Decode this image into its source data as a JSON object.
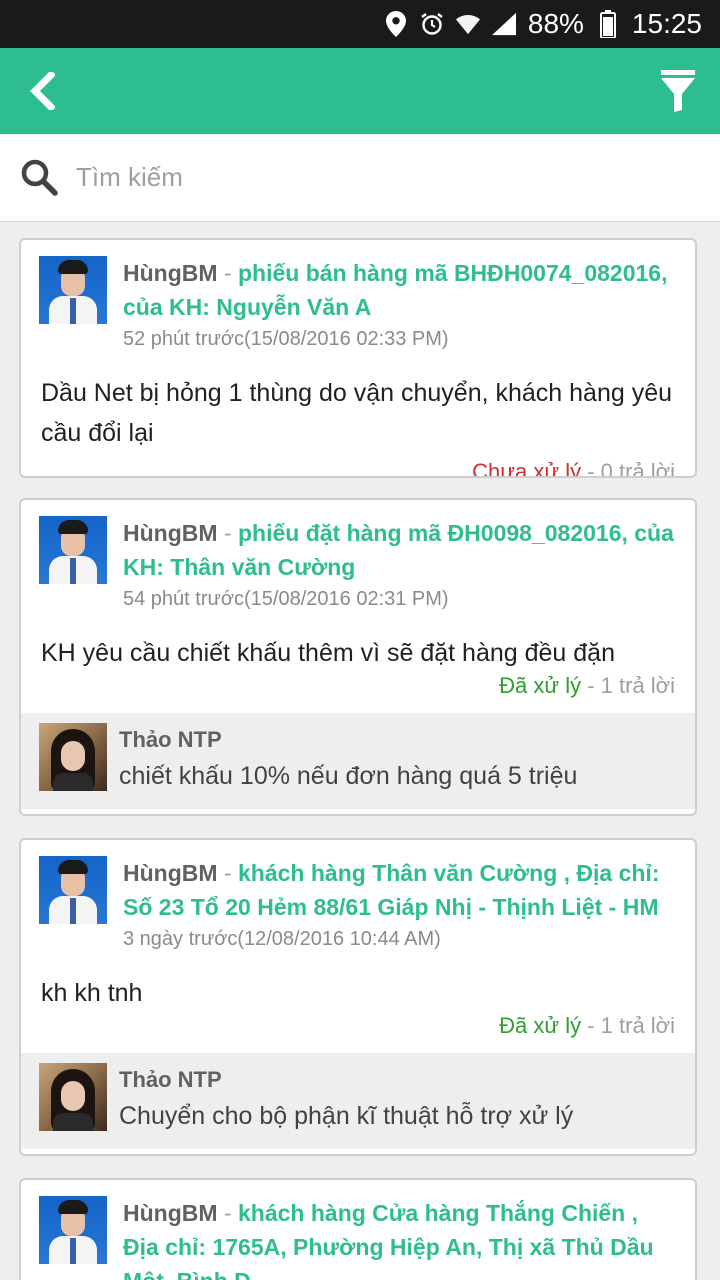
{
  "status_bar": {
    "battery": "88%",
    "time": "15:25"
  },
  "app_bar": {
    "back_icon": "chevron-left-icon",
    "filter_icon": "filter-icon"
  },
  "search": {
    "placeholder": "Tìm kiếm",
    "value": ""
  },
  "posts": [
    {
      "author": "HùngBM",
      "separator": " - ",
      "subject": "phiếu bán hàng mã BHĐH0074_082016, của KH: Nguyễn Văn A",
      "time": "52 phút trước(15/08/2016 02:33 PM)",
      "content": "Dầu Net bị hỏng 1 thùng do vận chuyển, khách hàng yêu cầu đổi lại",
      "status": "Chưa xử lý",
      "replies_count": " - 0 trả lời"
    },
    {
      "author": "HùngBM",
      "separator": " - ",
      "subject": "phiếu đặt hàng mã ĐH0098_082016, của KH: Thân văn Cường",
      "time": "54 phút trước(15/08/2016 02:31 PM)",
      "content": "KH yêu cầu chiết khấu thêm vì sẽ đặt hàng đều đặn",
      "status": "Đã xử lý",
      "replies_count": " - 1 trả lời",
      "reply": {
        "name": "Thảo NTP",
        "text": "chiết khấu 10% nếu đơn hàng quá 5 triệu"
      }
    },
    {
      "author": "HùngBM",
      "separator": " - ",
      "subject": "khách hàng Thân văn Cường , Địa chỉ: Số 23 Tổ 20 Hẻm 88/61 Giáp Nhị - Thịnh Liệt - HM",
      "time": "3 ngày trước(12/08/2016 10:44 AM)",
      "content": "kh kh tnh",
      "status": "Đã xử lý",
      "replies_count": " - 1 trả lời",
      "reply": {
        "name": "Thảo NTP",
        "text": "Chuyển cho bộ phận kĩ thuật hỗ trợ xử lý"
      }
    },
    {
      "author": "HùngBM",
      "separator": " - ",
      "subject": "khách hàng Cửa hàng Thắng Chiến , Địa chỉ: 1765A, Phường Hiệp An, Thị xã Thủ Dầu Một, Bình D"
    }
  ]
}
